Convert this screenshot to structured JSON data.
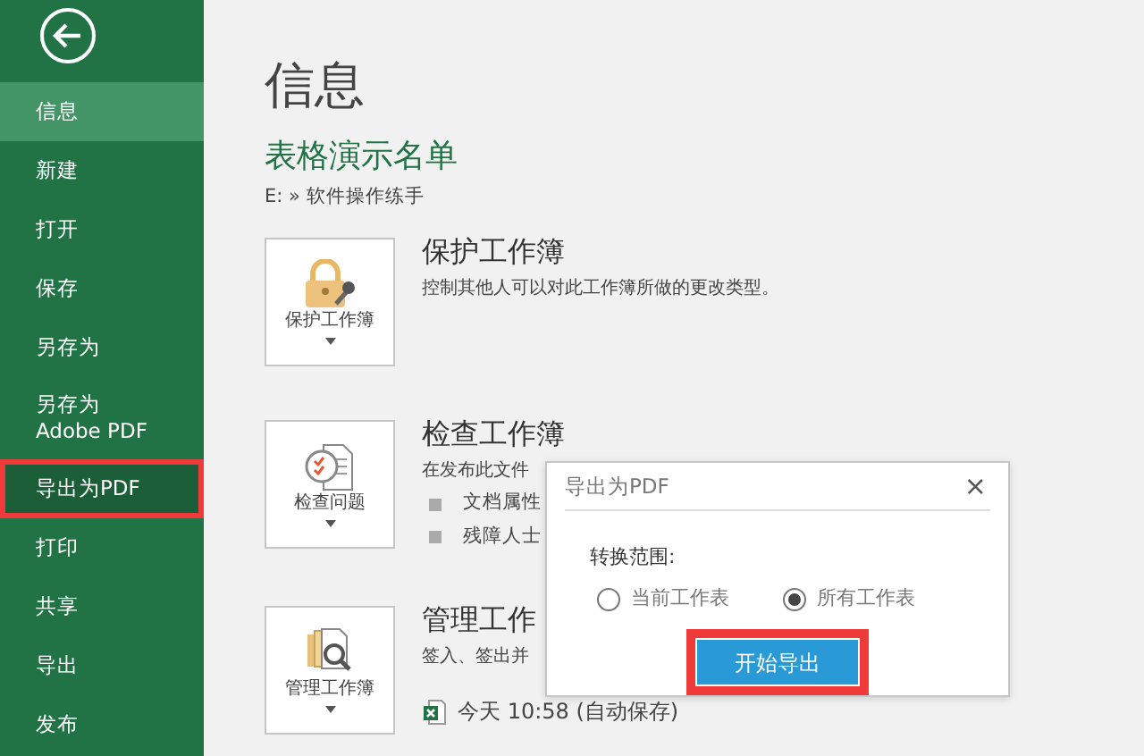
{
  "sidebar": {
    "items": [
      {
        "label": "信息",
        "selected": true,
        "highlighted": false
      },
      {
        "label": "新建",
        "selected": false,
        "highlighted": false
      },
      {
        "label": "打开",
        "selected": false,
        "highlighted": false
      },
      {
        "label": "保存",
        "selected": false,
        "highlighted": false
      },
      {
        "label": "另存为",
        "selected": false,
        "highlighted": false
      },
      {
        "label": "另存为 Adobe PDF",
        "selected": false,
        "highlighted": false
      },
      {
        "label": "导出为PDF",
        "selected": false,
        "highlighted": true
      },
      {
        "label": "打印",
        "selected": false,
        "highlighted": false
      },
      {
        "label": "共享",
        "selected": false,
        "highlighted": false
      },
      {
        "label": "导出",
        "selected": false,
        "highlighted": false
      },
      {
        "label": "发布",
        "selected": false,
        "highlighted": false
      }
    ]
  },
  "page_title": "信息",
  "workbook_name": "表格演示名单",
  "path": "E: » 软件操作练手",
  "sections": [
    {
      "kind": "protect",
      "button_label": "保护工作簿",
      "title": "保护工作簿",
      "description": "控制其他人可以对此工作簿所做的更改类型。"
    },
    {
      "kind": "inspect",
      "button_label": "检查问题",
      "title": "检查工作簿",
      "description": "在发布此文件",
      "bullets": [
        "文档属性",
        "残障人士"
      ]
    },
    {
      "kind": "manage",
      "button_label": "管理工作簿",
      "title": "管理工作",
      "description": "签入、签出并",
      "version": "今天 10:58 (自动保存)"
    }
  ],
  "dialog": {
    "title": "导出为PDF",
    "close": "×",
    "group_label": "转换范围:",
    "options": [
      {
        "label": "当前工作表",
        "selected": false
      },
      {
        "label": "所有工作表",
        "selected": true
      }
    ],
    "button": {
      "label": "开始导出",
      "highlighted": true
    }
  }
}
